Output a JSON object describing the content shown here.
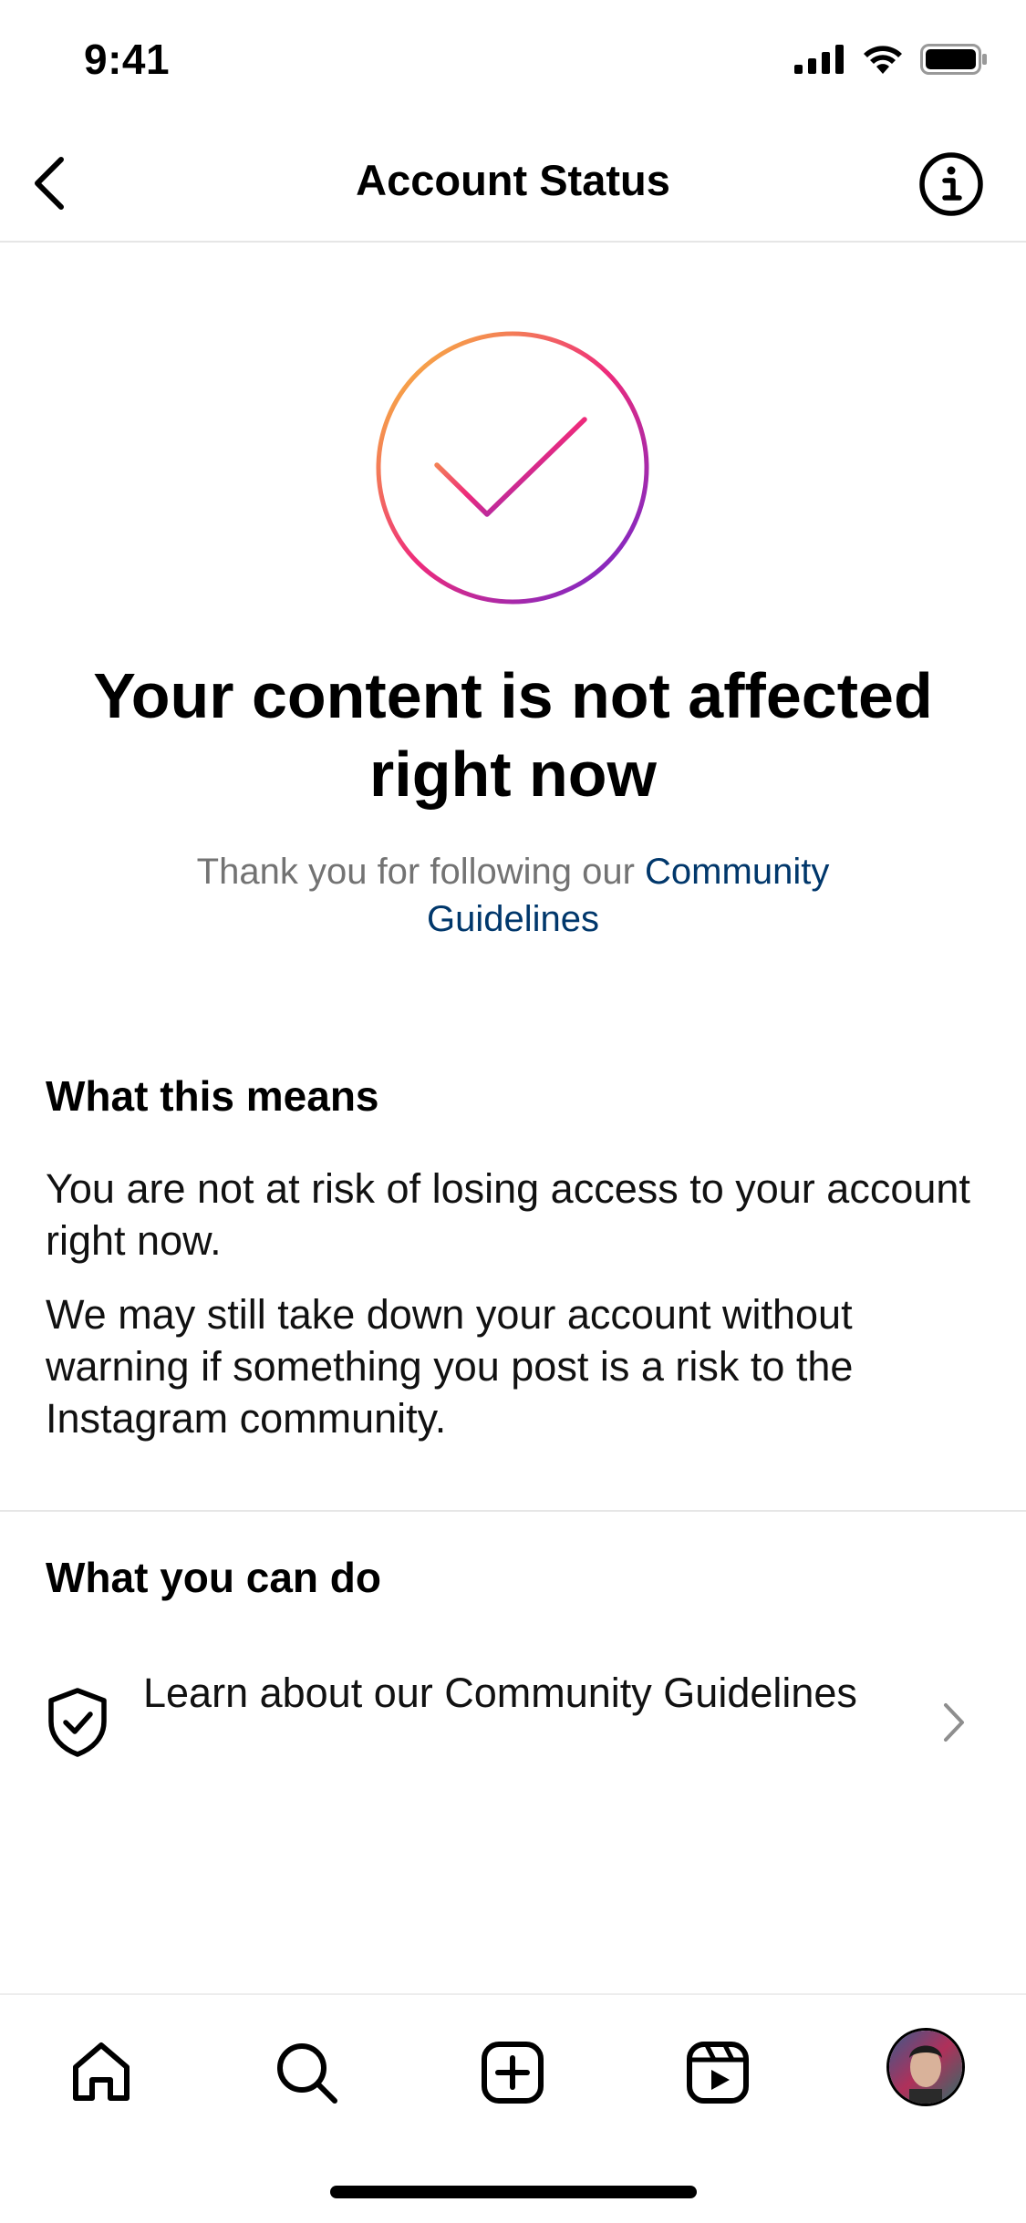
{
  "status_bar": {
    "time": "9:41"
  },
  "header": {
    "title": "Account Status"
  },
  "hero": {
    "headline": "Your content is not affected right now",
    "subtitle_prefix": "Thank you for following our ",
    "subtitle_link": "Community Guidelines"
  },
  "what_this_means": {
    "title": "What this means",
    "paragraph_1": "You are not at risk of losing access to your account right now.",
    "paragraph_2": "We may still take down your account without warning if something you post is a risk to the Instagram community."
  },
  "what_you_can_do": {
    "title": "What you can do",
    "items": [
      {
        "label": "Learn about our Community Guidelines",
        "icon": "shield-check-icon"
      }
    ]
  },
  "tab_bar": {
    "tabs": [
      "home-icon",
      "search-icon",
      "create-icon",
      "reels-icon",
      "profile-avatar"
    ]
  },
  "colors": {
    "link": "#00376b",
    "secondary_text": "#737373",
    "gradient": [
      "#f9ce34",
      "#ee2a7b",
      "#6228d7"
    ]
  }
}
